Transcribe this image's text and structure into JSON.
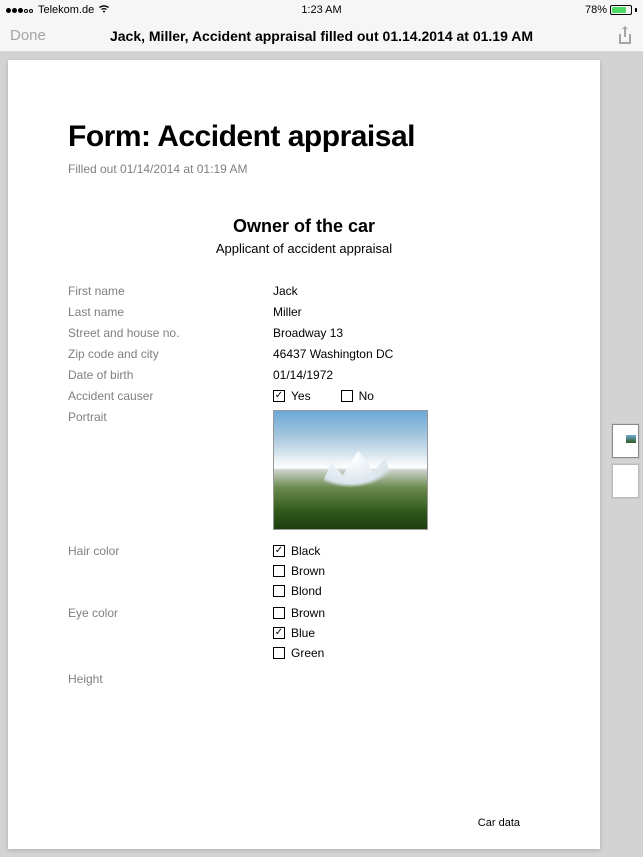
{
  "status": {
    "carrier": "Telekom.de",
    "time": "1:23 AM",
    "battery_pct": "78%"
  },
  "nav": {
    "done": "Done",
    "title": "Jack, Miller, Accident appraisal filled out 01.14.2014 at 01.19 AM"
  },
  "form": {
    "title": "Form: Accident appraisal",
    "subtitle": "Filled out 01/14/2014 at 01:19 AM",
    "section_title": "Owner of the car",
    "section_subtitle": "Applicant of accident appraisal",
    "labels": {
      "first_name": "First name",
      "last_name": "Last name",
      "street": "Street and house no.",
      "zip_city": "Zip code and city",
      "dob": "Date of birth",
      "accident_causer": "Accident causer",
      "portrait": "Portrait",
      "hair": "Hair color",
      "eye": "Eye color",
      "height": "Height"
    },
    "values": {
      "first_name": "Jack",
      "last_name": "Miller",
      "street": "Broadway 13",
      "zip_city": "46437 Washington DC",
      "dob": "01/14/1972"
    },
    "accident_opts": {
      "yes": "Yes",
      "no": "No",
      "yes_checked": true,
      "no_checked": false
    },
    "hair_opts": [
      {
        "label": "Black",
        "checked": true
      },
      {
        "label": "Brown",
        "checked": false
      },
      {
        "label": "Blond",
        "checked": false
      }
    ],
    "eye_opts": [
      {
        "label": "Brown",
        "checked": false
      },
      {
        "label": "Blue",
        "checked": true
      },
      {
        "label": "Green",
        "checked": false
      }
    ],
    "footer": "Car data"
  }
}
